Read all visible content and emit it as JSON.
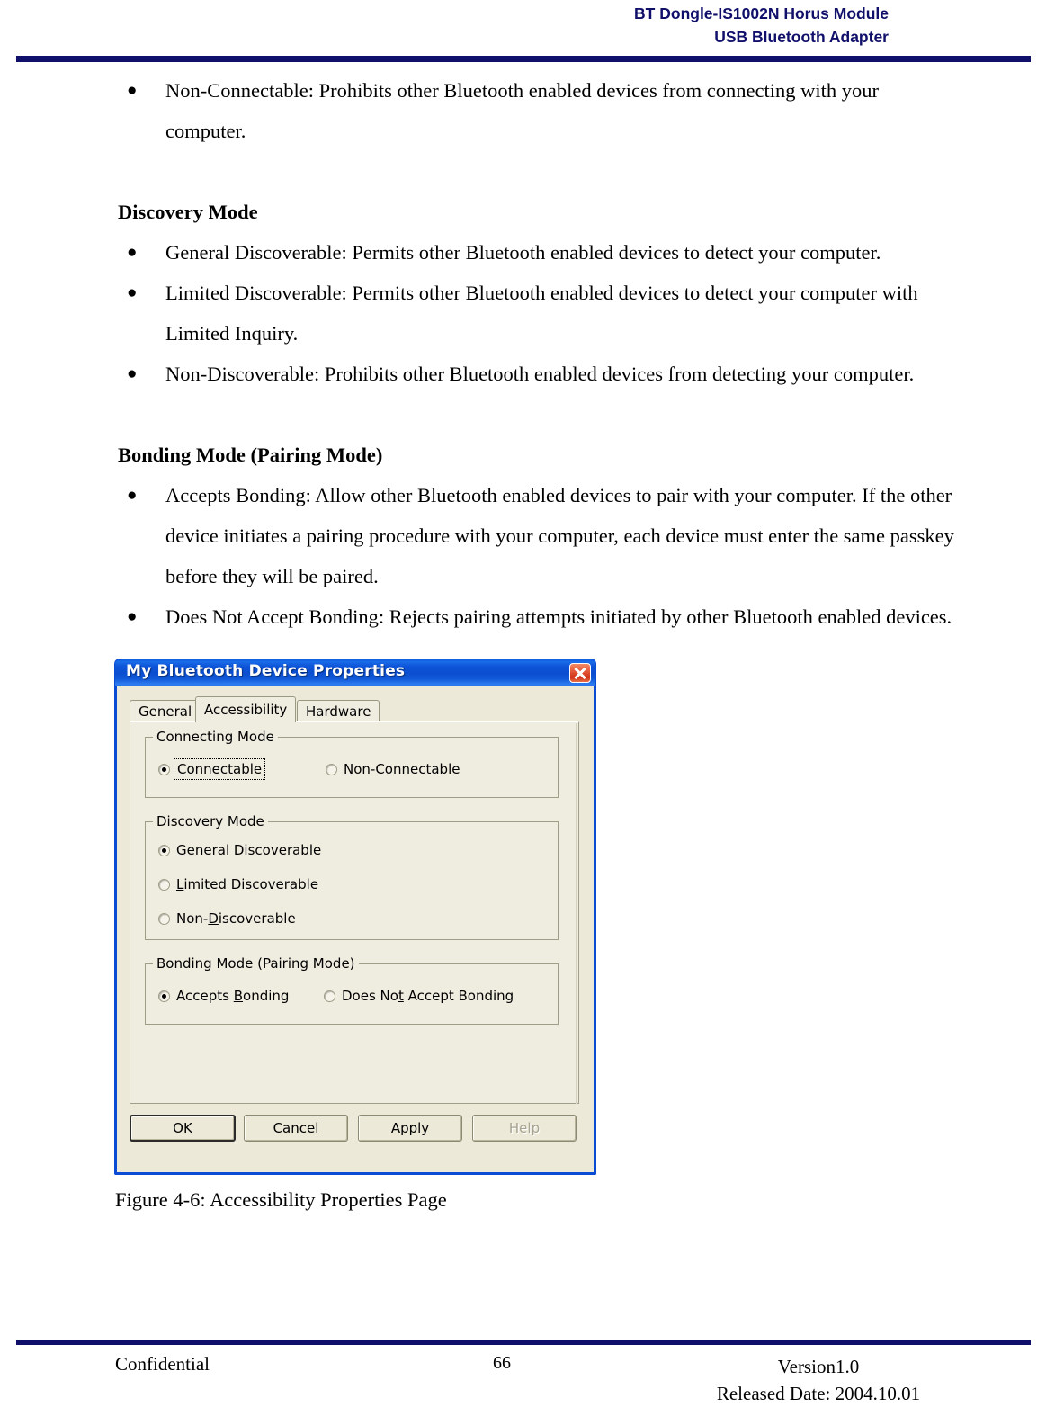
{
  "header": {
    "line1": "BT Dongle-IS1002N Horus Module",
    "line2": "USB Bluetooth Adapter",
    "accent_color": "#10106b"
  },
  "content": {
    "intro_bullets": [
      "Non-Connectable: Prohibits other Bluetooth enabled devices from connecting with your computer."
    ],
    "sections": [
      {
        "heading": "Discovery Mode",
        "bullets": [
          "General Discoverable: Permits other Bluetooth enabled devices to detect your computer.",
          "Limited Discoverable: Permits other Bluetooth enabled devices to detect your computer with Limited Inquiry.",
          "Non-Discoverable: Prohibits other Bluetooth enabled devices from detecting your computer."
        ]
      },
      {
        "heading": "Bonding Mode (Pairing Mode)",
        "bullets": [
          "Accepts Bonding: Allow other Bluetooth enabled devices to pair with your computer. If the other device initiates a pairing procedure with your computer, each device must enter the same passkey before they will be paired.",
          "Does Not Accept Bonding: Rejects pairing attempts initiated by other Bluetooth enabled devices."
        ]
      }
    ],
    "bullet_glyph": "●",
    "figure_caption": "Figure 4-6: Accessibility Properties Page"
  },
  "dialog": {
    "title": "My Bluetooth Device Properties",
    "close_icon": "close-icon",
    "titlebar_color": "#0b4ed0",
    "face_color": "#ece9d8",
    "tabs": [
      {
        "label": "General",
        "selected": false
      },
      {
        "label": "Accessibility",
        "selected": true
      },
      {
        "label": "Hardware",
        "selected": false
      }
    ],
    "groups": [
      {
        "title": "Connecting Mode",
        "options": [
          {
            "label": "Connectable",
            "accel": "C",
            "checked": true,
            "focused": true
          },
          {
            "label": "Non-Connectable",
            "accel": "N",
            "checked": false,
            "focused": false
          }
        ]
      },
      {
        "title": "Discovery Mode",
        "options": [
          {
            "label": "General Discoverable",
            "accel": "G",
            "checked": true,
            "focused": false
          },
          {
            "label": "Limited Discoverable",
            "accel": "L",
            "checked": false,
            "focused": false
          },
          {
            "label": "Non-Discoverable",
            "accel": "D",
            "checked": false,
            "focused": false
          }
        ]
      },
      {
        "title": "Bonding Mode (Pairing Mode)",
        "options": [
          {
            "label": "Accepts Bonding",
            "accel": "B",
            "checked": true,
            "focused": false
          },
          {
            "label": "Does Not Accept Bonding",
            "accel": "t",
            "checked": false,
            "focused": false
          }
        ]
      }
    ],
    "buttons": [
      {
        "label": "OK",
        "default": true,
        "disabled": false
      },
      {
        "label": "Cancel",
        "default": false,
        "disabled": false
      },
      {
        "label": "Apply",
        "default": false,
        "disabled": false,
        "accel": "A"
      },
      {
        "label": "Help",
        "default": false,
        "disabled": true
      }
    ]
  },
  "footer": {
    "left": "Confidential",
    "page_number": "66",
    "version": "Version1.0",
    "released": "Released Date: 2004.10.01"
  }
}
